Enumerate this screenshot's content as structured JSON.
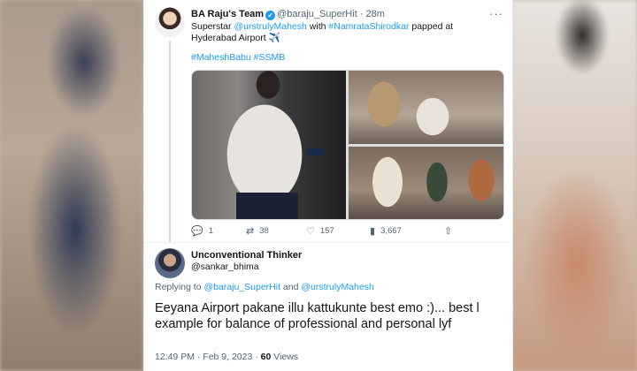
{
  "tweet": {
    "display_name": "BA Raju's Team",
    "handle": "@baraju_SuperHit",
    "time": "28m",
    "more": "···",
    "text_prefix": "Superstar ",
    "mention1": "@urstrulyMahesh",
    "text_mid": " with ",
    "hashtag1": "#NamrataShirodkar",
    "text_suffix": " papped at",
    "text_line2": "Hyderabad Airport ✈️",
    "hashtags": "#MaheshBabu #SSMB",
    "actions": [
      {
        "icon": "reply-icon",
        "glyph": "💬",
        "count": "1"
      },
      {
        "icon": "retweet-icon",
        "glyph": "⇄",
        "count": "38"
      },
      {
        "icon": "like-icon",
        "glyph": "♡",
        "count": "157"
      },
      {
        "icon": "views-icon",
        "glyph": "▮",
        "count": "3,667"
      },
      {
        "icon": "share-icon",
        "glyph": "⇧",
        "count": ""
      }
    ]
  },
  "reply": {
    "display_name": "Unconventional Thinker",
    "handle": "@sankar_bhima",
    "replying_to_label": "Replying to ",
    "replying_to_1": "@baraju_SuperHit",
    "replying_and": " and ",
    "replying_to_2": "@urstrulyMahesh",
    "text": "Eeyana Airport pakane illu kattukunte best emo :)... best l example for balance of professional and personal lyf",
    "timestamp": "12:49 PM · Feb 9, 2023 · ",
    "views_count": "60",
    "views_label": " Views"
  },
  "colors": {
    "link": "#1d9bf0",
    "secondary_text": "#536471",
    "verified": "#1d9bf0"
  }
}
